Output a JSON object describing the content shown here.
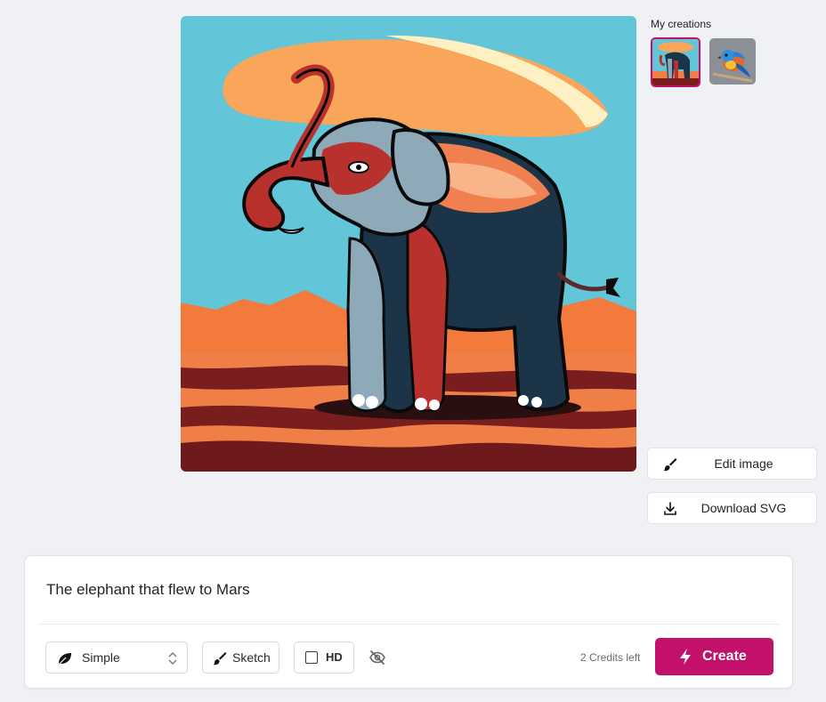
{
  "gallery": {
    "title": "My creations",
    "items": [
      {
        "subject": "elephant",
        "selected": true
      },
      {
        "subject": "bird",
        "selected": false
      }
    ]
  },
  "actions": {
    "edit_label": "Edit image",
    "download_label": "Download SVG"
  },
  "composer": {
    "prompt": "The elephant that flew to Mars",
    "style_value": "Simple",
    "sketch_label": "Sketch",
    "hd_label": "HD",
    "hd_checked": false,
    "credits_text": "2 Credits left",
    "create_label": "Create"
  },
  "colors": {
    "accent": "#c3106a",
    "background": "#f0f1f5"
  }
}
